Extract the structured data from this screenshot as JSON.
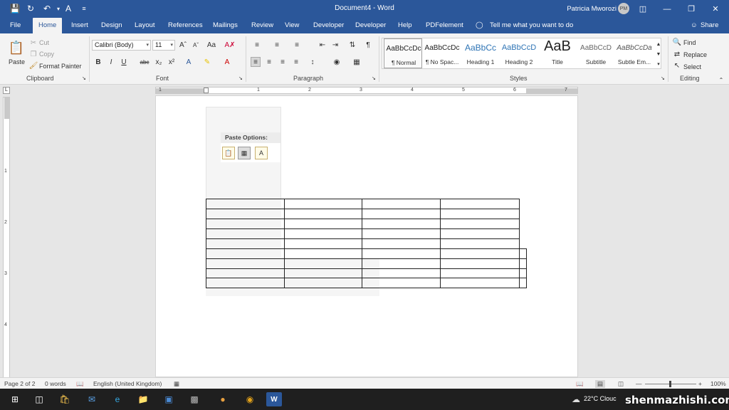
{
  "window": {
    "title": "Document4  -  Word",
    "user_name": "Patricia Mworozi",
    "user_initials": "PM",
    "accent": "#2b579a"
  },
  "tabs": [
    "File",
    "Home",
    "Insert",
    "Design",
    "Layout",
    "References",
    "Mailings",
    "Review",
    "View",
    "Developer",
    "Developer",
    "Help",
    "PDFelement"
  ],
  "tell_me": "Tell me what you want to do",
  "share_label": "Share",
  "clipboard": {
    "paste": "Paste",
    "cut": "Cut",
    "copy": "Copy",
    "format_painter": "Format Painter",
    "group": "Clipboard"
  },
  "font": {
    "family": "Calibri (Body)",
    "size": "11",
    "group": "Font"
  },
  "paragraph": {
    "group": "Paragraph"
  },
  "styles": {
    "group": "Styles",
    "items": [
      {
        "preview": "AaBbCcDc",
        "label": "¶ Normal"
      },
      {
        "preview": "AaBbCcDc",
        "label": "¶ No Spac..."
      },
      {
        "preview": "AaBbCc",
        "label": "Heading 1"
      },
      {
        "preview": "AaBbCcD",
        "label": "Heading 2"
      },
      {
        "preview": "AaB",
        "label": "Title"
      },
      {
        "preview": "AaBbCcD",
        "label": "Subtitle"
      },
      {
        "preview": "AaBbCcDa",
        "label": "Subtle Em..."
      }
    ]
  },
  "editing": {
    "group": "Editing",
    "find": "Find",
    "replace": "Replace",
    "select": "Select"
  },
  "paste_options": {
    "title": "Paste Options:"
  },
  "ruler_numbers": [
    "1",
    "1",
    "2",
    "3",
    "4",
    "5",
    "6",
    "7"
  ],
  "vruler_numbers": [
    "1",
    "2",
    "3",
    "4"
  ],
  "status": {
    "page": "Page 2 of 2",
    "words": "0 words",
    "language": "English (United Kingdom)",
    "zoom": "100%"
  },
  "taskbar": {
    "weather": "22°C  Clouc",
    "watermark": "shenmazhishi.com"
  }
}
